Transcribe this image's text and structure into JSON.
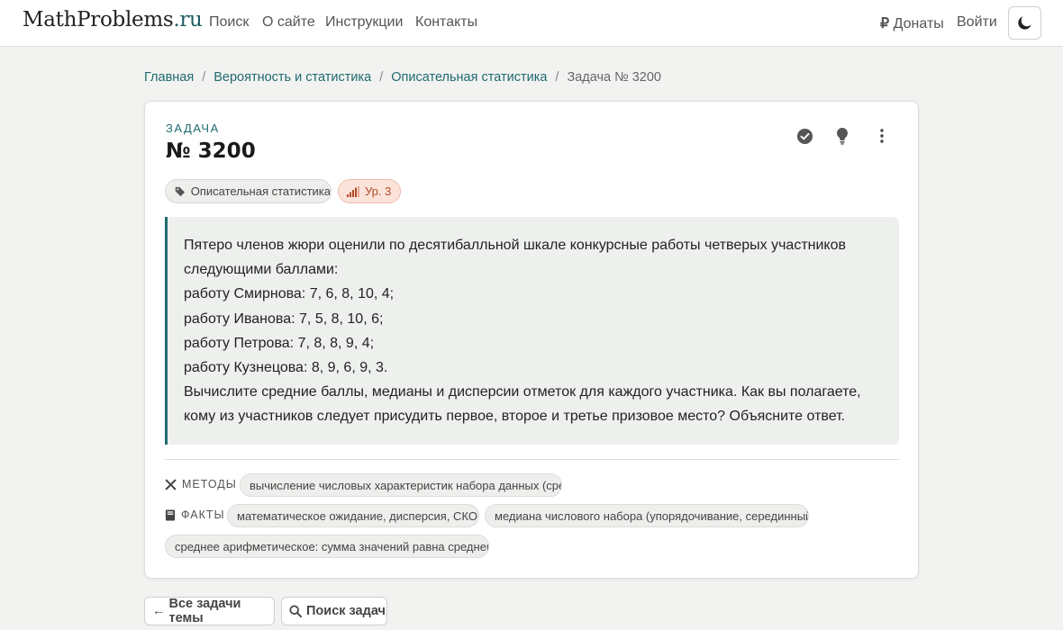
{
  "navbar": {
    "brand_main": "MathProblems",
    "brand_suffix": ".ru",
    "links": [
      "Поиск",
      "О сайте",
      "Инструкции",
      "Контакты"
    ],
    "donate": "Донаты",
    "login": "Войти"
  },
  "breadcrumb": {
    "items": [
      "Главная",
      "Вероятность и статистика",
      "Описательная статистика"
    ],
    "current": "Задача № 3200"
  },
  "problem": {
    "eyebrow": "ЗАДАЧА",
    "title": "№ 3200",
    "tag": "Описательная статистика",
    "level": "Ур. 3",
    "lines": [
      "Пятеро членов жюри оценили по десятибалльной шкале конкурсные работы четверых участников",
      "следующими баллами:",
      "работу Смирнова: 7, 6, 8, 10, 4;",
      "работу Иванова: 7, 5, 8, 10, 6;",
      "работу Петрова: 7, 8, 8, 9, 4;",
      "работу Кузнецова: 8, 9, 6, 9, 3.",
      "Вычислите средние баллы, медианы и дисперсии отметок для каждого участника. Как вы полагаете,",
      "кому из участников следует присудить первое, второе и третье призовое место? Объясните ответ."
    ]
  },
  "meta": {
    "methods_label": "МЕТОДЫ",
    "methods": [
      "вычисление числовых характеристик набора данных (сред"
    ],
    "facts_label": "ФАКТЫ",
    "facts": [
      "математическое ожидание, дисперсия, СКО",
      "медиана числового набора (упорядочивание, серединный",
      "среднее арифметическое: сумма значений равна среднему"
    ]
  },
  "footer": {
    "all_tasks": "Все задачи темы",
    "search_tasks": "Поиск задач"
  }
}
